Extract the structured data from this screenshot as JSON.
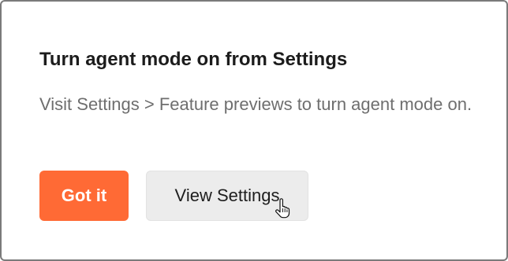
{
  "dialog": {
    "title": "Turn agent mode on from Settings",
    "message": "Visit Settings > Feature previews to turn agent mode on.",
    "primary_button": "Got it",
    "secondary_button": "View Settings",
    "accent_color": "#ff6a35"
  },
  "cursor": {
    "icon": "hand-pointer-icon"
  }
}
